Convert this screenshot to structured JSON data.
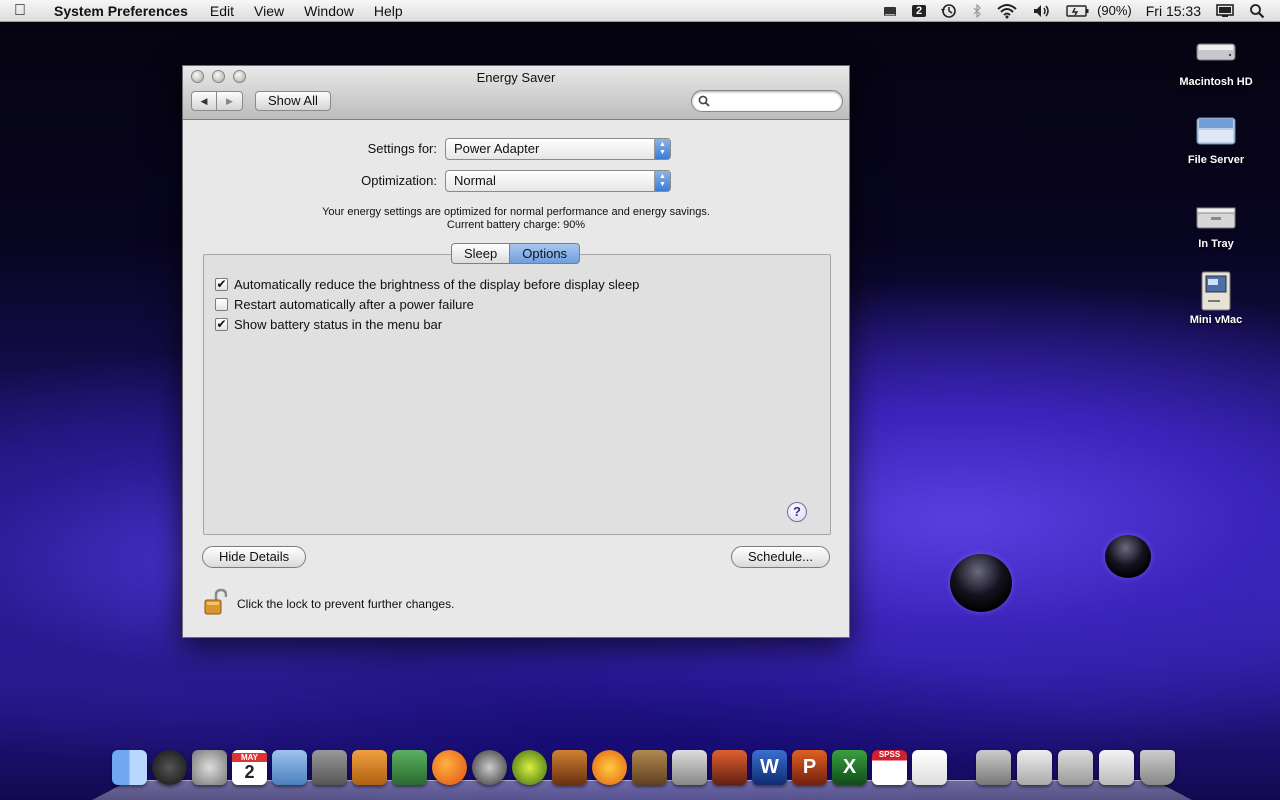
{
  "menubar": {
    "app": "System Preferences",
    "items": [
      "Edit",
      "View",
      "Window",
      "Help"
    ],
    "battery_pct": "(90%)",
    "clock": "Fri 15:33",
    "spaces_number": "2"
  },
  "desktop_icons": [
    {
      "label": "Macintosh HD"
    },
    {
      "label": "File Server"
    },
    {
      "label": "In Tray"
    },
    {
      "label": "Mini vMac"
    }
  ],
  "window": {
    "title": "Energy Saver",
    "show_all": "Show All",
    "search_value": "",
    "settings_for_label": "Settings for:",
    "settings_for_value": "Power Adapter",
    "optimization_label": "Optimization:",
    "optimization_value": "Normal",
    "info_line1": "Your energy settings are optimized for normal performance and energy savings.",
    "info_line2": "Current battery charge: 90%",
    "tabs": [
      "Sleep",
      "Options"
    ],
    "options": [
      {
        "label": "Automatically reduce the brightness of the display before display sleep",
        "checked": true
      },
      {
        "label": "Restart automatically after a power failure",
        "checked": false
      },
      {
        "label": "Show battery status in the menu bar",
        "checked": true
      }
    ],
    "help": "?",
    "hide_details": "Hide Details",
    "schedule": "Schedule...",
    "lock_text": "Click the lock to prevent further changes."
  },
  "dock": {
    "calendar_month": "MAY",
    "calendar_day": "2",
    "spss_label": "SPSS",
    "word_letter": "W",
    "ppt_letter": "P",
    "excel_letter": "X"
  }
}
